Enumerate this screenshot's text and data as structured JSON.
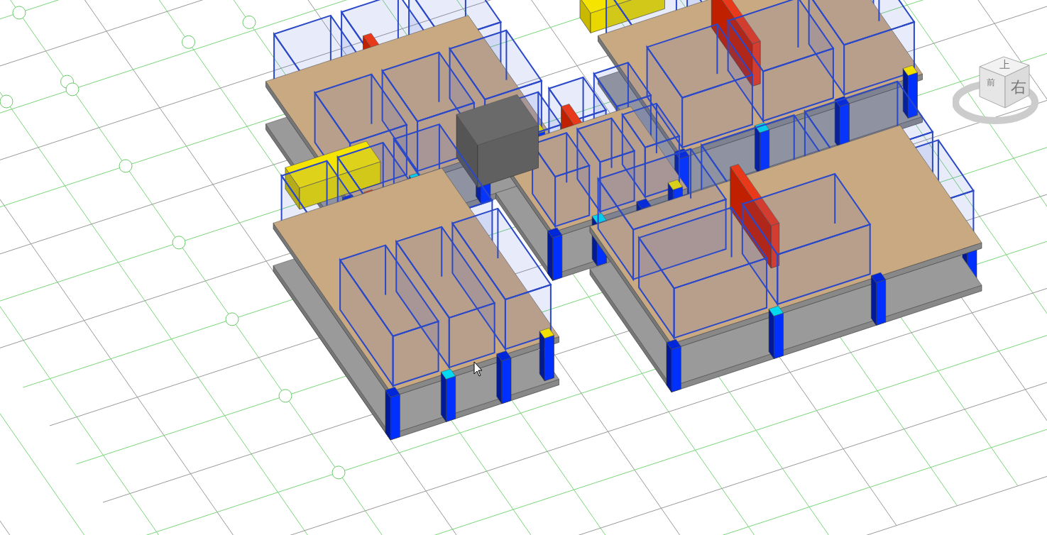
{
  "viewport": {
    "view_cube": {
      "faces": [
        {
          "label": "上",
          "kind": "top"
        },
        {
          "label": "前",
          "kind": "left"
        },
        {
          "label": "右",
          "kind": "right"
        }
      ]
    }
  }
}
